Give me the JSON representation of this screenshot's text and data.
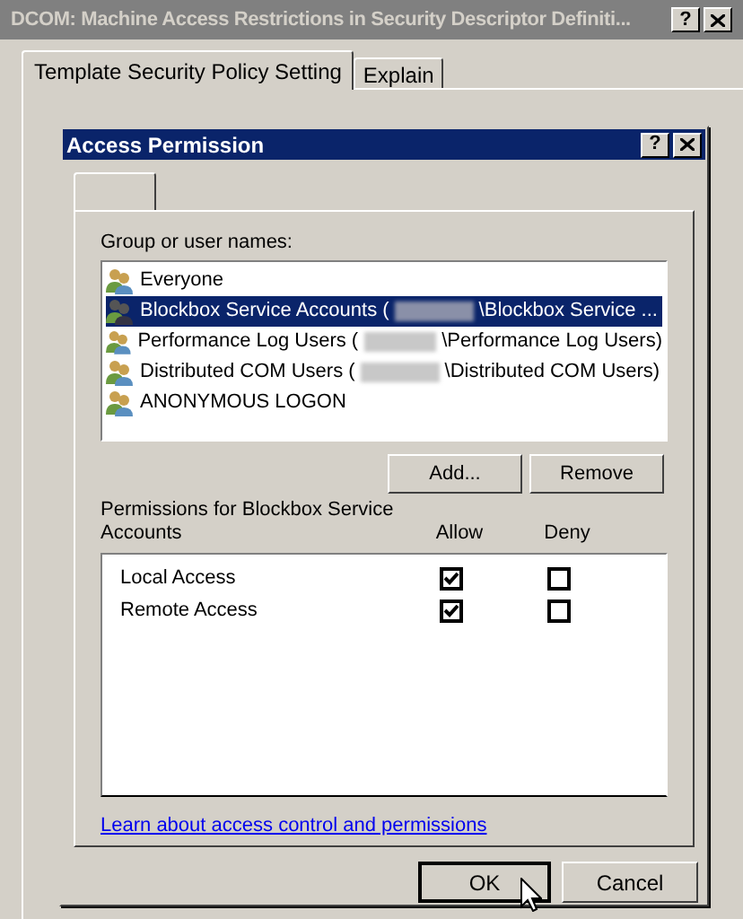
{
  "window": {
    "title": "DCOM: Machine Access Restrictions in Security Descriptor Definiti...",
    "help_button": "?"
  },
  "tabs": [
    {
      "label": "Template Security Policy Setting",
      "selected": true
    },
    {
      "label": "Explain",
      "selected": false
    }
  ],
  "dialog": {
    "title": "Access Permission",
    "help_button": "?",
    "group_label": "Group or user names:",
    "users": [
      {
        "name": "Everyone",
        "selected": false
      },
      {
        "name": "Blockbox Service Accounts (",
        "redacted": true,
        "name_after": "\\Blockbox Service ...",
        "selected": true
      },
      {
        "name": "Performance Log Users (",
        "redacted": true,
        "name_after": "\\Performance Log Users)",
        "selected": false
      },
      {
        "name": "Distributed COM Users (",
        "redacted": true,
        "name_after": "\\Distributed COM Users)",
        "selected": false
      },
      {
        "name": "ANONYMOUS LOGON",
        "selected": false
      }
    ],
    "buttons": [
      "Add...",
      "Remove"
    ],
    "permissions_label": "Permissions for Blockbox Service Accounts",
    "columns": [
      "Allow",
      "Deny"
    ],
    "permissions": [
      {
        "name": "Local Access",
        "allow": true,
        "deny": false
      },
      {
        "name": "Remote Access",
        "allow": true,
        "deny": false
      }
    ],
    "link": "Learn about access control and permissions",
    "footer_buttons": [
      {
        "label": "OK",
        "default": true
      },
      {
        "label": "Cancel",
        "default": false
      }
    ]
  }
}
